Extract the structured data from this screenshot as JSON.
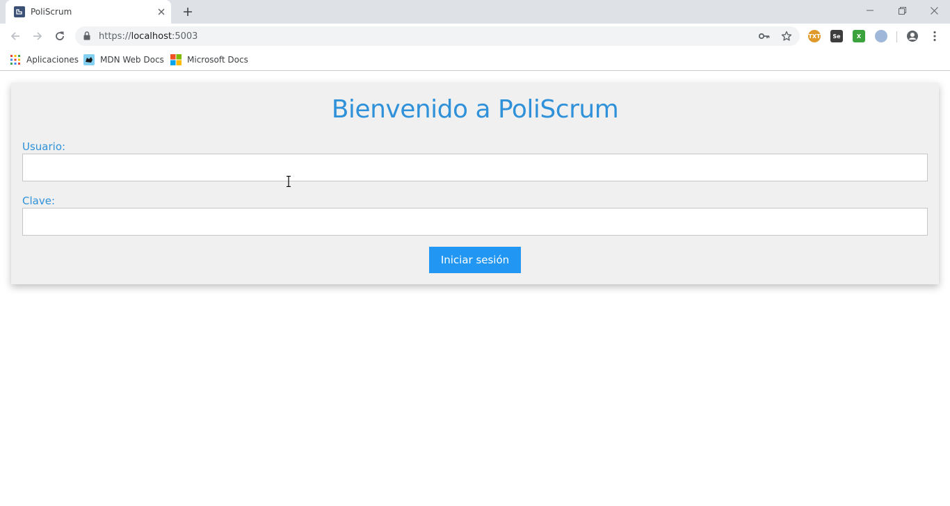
{
  "browser": {
    "tab": {
      "title": "PoliScrum"
    },
    "address": {
      "scheme": "https://",
      "host": "localhost",
      "port": ":5003"
    },
    "bookmarks": [
      {
        "label": "Aplicaciones",
        "icon": "apps-grid-icon"
      },
      {
        "label": "MDN Web Docs",
        "icon": "mdn-icon"
      },
      {
        "label": "Microsoft Docs",
        "icon": "microsoft-icon"
      }
    ],
    "extensions": [
      {
        "icon": "extension-text-icon",
        "text": "TXT"
      },
      {
        "icon": "selenium-ide-icon",
        "text": "Se"
      },
      {
        "icon": "excel-extension-icon",
        "text": "X"
      },
      {
        "icon": "blue-orb-extension-icon",
        "text": ""
      }
    ]
  },
  "login": {
    "title": "Bienvenido a PoliScrum",
    "user_label": "Usuario:",
    "user_value": "",
    "password_label": "Clave:",
    "password_value": "",
    "submit_label": "Iniciar sesión"
  },
  "colors": {
    "accent": "#2e91d9",
    "button": "#2196f3",
    "card_bg": "#f0f0f0"
  }
}
